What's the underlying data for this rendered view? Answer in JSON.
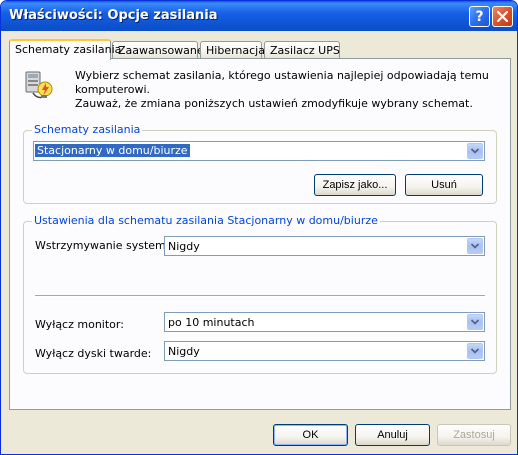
{
  "window": {
    "title": "Właściwości: Opcje zasilania"
  },
  "tabs": [
    {
      "label": "Schematy zasilania",
      "active": true
    },
    {
      "label": "Zaawansowane",
      "active": false
    },
    {
      "label": "Hibernacja",
      "active": false
    },
    {
      "label": "Zasilacz UPS",
      "active": false
    }
  ],
  "info": {
    "icon": "power-schemes-icon",
    "line1": "Wybierz schemat zasilania, którego ustawienia najlepiej odpowiadają temu komputerowi.",
    "line2": "Zauważ, że zmiana poniższych ustawień zmodyfikuje wybrany schemat."
  },
  "schemes_group": {
    "title": "Schematy zasilania",
    "selected": "Stacjonarny w domu/biurze",
    "save_as_label": "Zapisz jako...",
    "delete_label": "Usuń"
  },
  "settings_group": {
    "title": "Ustawienia dla schematu zasilania Stacjonarny w domu/biurze",
    "standby_label": "Wstrzymywanie systemu:",
    "standby_value": "Nigdy",
    "monitor_label": "Wyłącz monitor:",
    "monitor_value": "po 10 minutach",
    "disks_label": "Wyłącz dyski twarde:",
    "disks_value": "Nigdy"
  },
  "footer": {
    "ok_label": "OK",
    "cancel_label": "Anuluj",
    "apply_label": "Zastosuj"
  },
  "colors": {
    "titlebar": "#0f57d6",
    "accent": "#0046d5",
    "selection": "#316ac5",
    "tab_highlight": "#ffc83c"
  }
}
